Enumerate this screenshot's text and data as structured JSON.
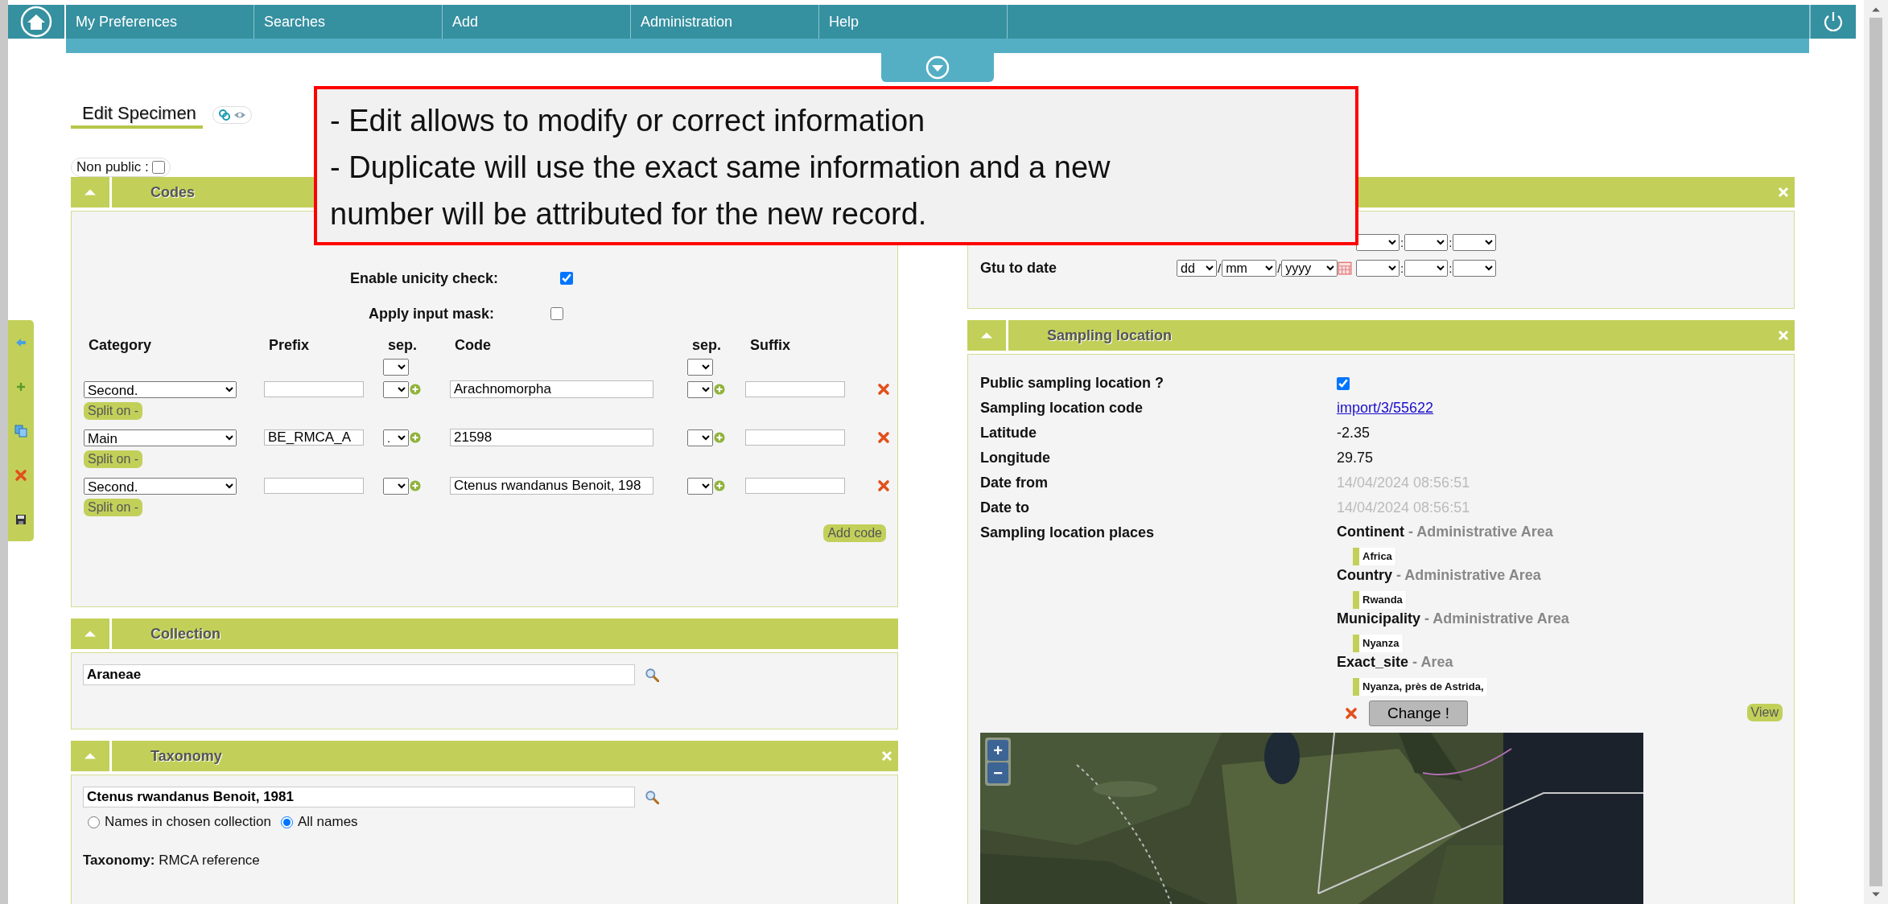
{
  "nav": {
    "items": [
      "My Preferences",
      "Searches",
      "Add",
      "Administration",
      "Help"
    ]
  },
  "page_title": "Edit Specimen",
  "non_public": {
    "label": "Non public :",
    "checked": false
  },
  "callout": {
    "lines": [
      "- Edit allows to modify or correct information",
      "- Duplicate will use the exact same information and a new number will be attributed for the new record."
    ]
  },
  "codes_panel": {
    "title": "Codes",
    "options": [
      {
        "label": "Enable unicity check:",
        "checked": true
      },
      {
        "label": "Apply input mask:",
        "checked": false
      }
    ],
    "columns": [
      "Category",
      "Prefix",
      "sep.",
      "Code",
      "sep.",
      "Suffix"
    ],
    "rows": [
      {
        "category": "Second.",
        "code": "Arachnomorpha",
        "split_button": "Split on -"
      },
      {
        "category": "Main",
        "prefix": "BE_RMCA_A",
        "separator": ".",
        "code": "21598",
        "split_button": "Split on -"
      },
      {
        "category": "Second.",
        "code": "Ctenus rwandanus Benoit, 198",
        "split_button": "Split on -"
      }
    ],
    "add_button": "Add code"
  },
  "collection_panel": {
    "title": "Collection",
    "value": "Araneae"
  },
  "taxonomy_panel": {
    "title": "Taxonomy",
    "value": "Ctenus rwandanus Benoit, 1981",
    "scope_options": [
      {
        "label": "Names in chosen collection",
        "selected": false
      },
      {
        "label": "All names",
        "selected": true
      }
    ],
    "taxonomy_line": "**Taxonomy:** RMCA reference"
  },
  "date_panel": {
    "rows": [
      {
        "time_separators": [
          ":",
          ":"
        ]
      },
      {
        "label": "Gtu to date",
        "day": "dd",
        "month": "mm",
        "year": "yyyy",
        "date_separators": [
          "/",
          "/"
        ],
        "time_separators": [
          ":",
          ":"
        ]
      }
    ]
  },
  "sampling_panel": {
    "title": "Sampling location",
    "fields": [
      {
        "kind": "checkbox",
        "label": "Public sampling location ?",
        "checked": true
      },
      {
        "kind": "link",
        "label": "Sampling location code",
        "value": "import/3/55622"
      },
      {
        "kind": "text",
        "label": "Latitude",
        "value": "-2.35"
      },
      {
        "kind": "text",
        "label": "Longitude",
        "value": "29.75"
      },
      {
        "kind": "muted",
        "label": "Date from",
        "value": "14/04/2024 08:56:51"
      },
      {
        "kind": "muted",
        "label": "Date to",
        "value": "14/04/2024 08:56:51"
      }
    ],
    "places_label": "Sampling location places",
    "places": [
      {
        "type": "Continent",
        "category": "- Administrative Area",
        "value": "Africa"
      },
      {
        "type": "Country",
        "category": "- Administrative Area",
        "value": "Rwanda"
      },
      {
        "type": "Municipality",
        "category": "- Administrative Area",
        "value": "Nyanza"
      },
      {
        "type": "Exact_site",
        "category": "- Area",
        "value": "Nyanza, près de Astrida,"
      }
    ],
    "change_button": "Change !",
    "view_button": "View",
    "map": {
      "zoom_in": "+",
      "zoom_out": "−"
    }
  }
}
